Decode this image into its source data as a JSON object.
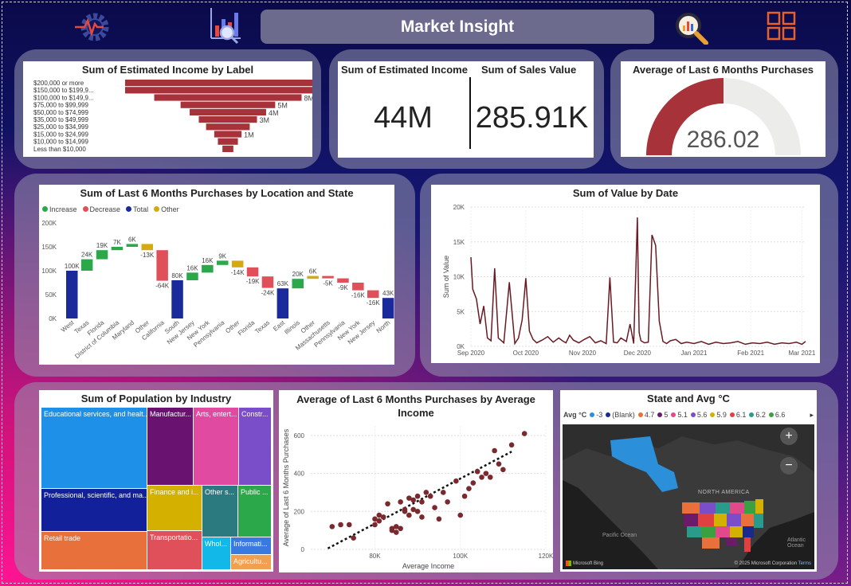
{
  "header": {
    "title": "Market Insight"
  },
  "icons": {
    "pulse": "settings-pulse-icon",
    "analytics": "analytics-chart-icon",
    "search": "search-analytics-icon",
    "grid": "grid-menu-icon"
  },
  "income_label": {
    "title": "Sum of Estimated Income by Label",
    "labels": [
      "$200,000 or more",
      "$150,000 to $199,9...",
      "$100,000 to $149,9...",
      "$75,000 to $99,999",
      "$50,000 to $74,999",
      "$35,000 to $49,999",
      "$25,000 to $34,999",
      "$15,000 to $24,999",
      "$10,000 to $14,999",
      "Less than $10,000"
    ],
    "data_labels": [
      "",
      "",
      "8M",
      "5M",
      "4M",
      "3M",
      "",
      "1M",
      "",
      ""
    ]
  },
  "kpi": {
    "income_title": "Sum of Estimated Income",
    "income_value": "44M",
    "sales_title": "Sum of Sales Value",
    "sales_value": "285.91K"
  },
  "gauge": {
    "title": "Average of Last 6 Months Purchases",
    "value": "286.02"
  },
  "waterfall": {
    "title": "Sum of Last 6 Months Purchases by Location and State",
    "legend": [
      "Increase",
      "Decrease",
      "Total",
      "Other"
    ],
    "yticks": [
      "200K",
      "150K",
      "100K",
      "50K",
      "0K"
    ]
  },
  "line": {
    "title": "Sum of Value by Date",
    "ylabel": "Sum of Value",
    "yticks": [
      "20K",
      "15K",
      "10K",
      "5K",
      "0K"
    ],
    "xticks": [
      "Sep 2020",
      "Oct 2020",
      "Nov 2020",
      "Dec 2020",
      "Jan 2021",
      "Feb 2021",
      "Mar 2021"
    ]
  },
  "treemap": {
    "title": "Sum of Population by Industry",
    "cells": [
      "Educational services, and healt...",
      "Manufactur...",
      "Arts, entert...",
      "Constr...",
      "Professional, scientific, and ma...",
      "Finance and i...",
      "Other s...",
      "Public ...",
      "Retail trade",
      "Transportatio...",
      "Whol...",
      "Informati...",
      "Agricultu..."
    ]
  },
  "scatter": {
    "title_line1": "Average of Last 6 Months Purchases by Average",
    "title_line2": "Income",
    "ylabel": "Average of Last 6 Months Purchases",
    "xlabel": "Average Income",
    "yticks": [
      "600",
      "400",
      "200",
      "0"
    ],
    "xticks": [
      "80K",
      "100K",
      "120K"
    ]
  },
  "map": {
    "title": "State and Avg °C",
    "legend_label": "Avg °C",
    "legend": [
      "-3",
      "(Blank)",
      "4.7",
      "5",
      "5.1",
      "5.6",
      "5.9",
      "6.1",
      "6.2",
      "6.6"
    ],
    "legend_colors": [
      "#2b8fd9",
      "#1a2a8a",
      "#e8703a",
      "#6a1b6a",
      "#e04a8a",
      "#7a4ec8",
      "#d4b000",
      "#e04040",
      "#2a9a8a",
      "#3aa040"
    ],
    "na_label": "NORTH AMERICA",
    "ocean_label": "Pacific Ocean",
    "ocean2_label": "Atlantic Ocean",
    "brand": "Microsoft Bing",
    "copyright": "© 2025 Microsoft Corporation",
    "terms": "Terms",
    "zoom_in": "+",
    "zoom_out": "−"
  },
  "chart_data": [
    {
      "type": "bar",
      "title": "Sum of Estimated Income by Label",
      "categories": [
        "$200,000 or more",
        "$150,000 to $199,9...",
        "$100,000 to $149,9...",
        "$75,000 to $99,999",
        "$50,000 to $74,999",
        "$35,000 to $49,999",
        "$25,000 to $34,999",
        "$15,000 to $24,999",
        "$10,000 to $14,999",
        "Less than $10,000"
      ],
      "values": [
        11.3,
        11.3,
        8.1,
        5.2,
        4.2,
        3.2,
        2.4,
        1.5,
        1.1,
        0.6
      ],
      "units": "M"
    },
    {
      "type": "bar",
      "subtype": "waterfall",
      "title": "Sum of Last 6 Months Purchases by Location and State",
      "categories": [
        "West",
        "Texas",
        "Florida",
        "District of Columbia",
        "Maryland",
        "Other",
        "California",
        "South",
        "New Jersey",
        "New York",
        "Pennsylvania",
        "Other",
        "Florida",
        "Texas",
        "East",
        "Illinois",
        "Other",
        "Massachusetts",
        "Pennsylvania",
        "New York",
        "New Jersey",
        "North"
      ],
      "kinds": [
        "total",
        "inc",
        "inc",
        "inc",
        "inc",
        "other",
        "dec",
        "total",
        "inc",
        "inc",
        "inc",
        "other",
        "dec",
        "dec",
        "total",
        "inc",
        "other",
        "dec",
        "dec",
        "dec",
        "dec",
        "total"
      ],
      "values": [
        100,
        24,
        19,
        7,
        6,
        -13,
        -64,
        80,
        16,
        16,
        9,
        -14,
        -19,
        -24,
        63,
        20,
        6,
        -5,
        -9,
        -16,
        -16,
        43
      ],
      "labels": [
        "100K",
        "24K",
        "19K",
        "7K",
        "6K",
        "-13K",
        "-64K",
        "80K",
        "16K",
        "16K",
        "9K",
        "-14K",
        "-19K",
        "-24K",
        "63K",
        "20K",
        "6K",
        "-5K",
        "-9K",
        "-16K",
        "-16K",
        "43K"
      ],
      "ylim": [
        0,
        200
      ],
      "units": "K"
    },
    {
      "type": "line",
      "title": "Sum of Value by Date",
      "xlabel": "",
      "ylabel": "Sum of Value",
      "ylim": [
        0,
        20000
      ],
      "x": [
        "2020-09-01",
        "2020-09-02",
        "2020-09-04",
        "2020-09-06",
        "2020-09-08",
        "2020-09-10",
        "2020-09-12",
        "2020-09-14",
        "2020-09-16",
        "2020-09-19",
        "2020-09-22",
        "2020-09-25",
        "2020-09-27",
        "2020-09-29",
        "2020-10-01",
        "2020-10-03",
        "2020-10-05",
        "2020-10-07",
        "2020-10-10",
        "2020-10-13",
        "2020-10-16",
        "2020-10-19",
        "2020-10-21",
        "2020-10-23",
        "2020-10-25",
        "2020-10-27",
        "2020-10-30",
        "2020-11-02",
        "2020-11-05",
        "2020-11-08",
        "2020-11-11",
        "2020-11-14",
        "2020-11-16",
        "2020-11-18",
        "2020-11-20",
        "2020-11-22",
        "2020-11-25",
        "2020-11-27",
        "2020-11-29",
        "2020-12-01",
        "2020-12-02",
        "2020-12-03",
        "2020-12-05",
        "2020-12-07",
        "2020-12-09",
        "2020-12-11",
        "2020-12-13",
        "2020-12-15",
        "2020-12-17",
        "2020-12-19",
        "2020-12-22",
        "2020-12-25",
        "2020-12-28",
        "2021-01-01",
        "2021-01-05",
        "2021-01-09",
        "2021-01-13",
        "2021-01-17",
        "2021-01-21",
        "2021-01-25",
        "2021-01-29",
        "2021-02-02",
        "2021-02-06",
        "2021-02-10",
        "2021-02-14",
        "2021-02-18",
        "2021-02-22",
        "2021-02-26",
        "2021-03-01",
        "2021-03-03"
      ],
      "y": [
        12800,
        8200,
        6800,
        3200,
        5800,
        1200,
        800,
        11200,
        1200,
        500,
        9200,
        400,
        1200,
        3800,
        9800,
        2200,
        1000,
        500,
        900,
        1400,
        600,
        1200,
        800,
        500,
        1600,
        900,
        500,
        1000,
        1400,
        500,
        800,
        400,
        9900,
        600,
        500,
        1200,
        700,
        3200,
        400,
        18500,
        2000,
        800,
        500,
        600,
        16000,
        14500,
        3600,
        700,
        400,
        800,
        1000,
        400,
        600,
        400,
        700,
        300,
        600,
        400,
        500,
        700,
        300,
        500,
        400,
        600,
        300,
        500,
        400,
        600,
        300,
        700
      ]
    },
    {
      "type": "scatter",
      "title": "Average of Last 6 Months Purchases by Average Income",
      "xlabel": "Average Income",
      "ylabel": "Average of Last 6 Months Purchases",
      "xlim": [
        65000,
        120000
      ],
      "ylim": [
        0,
        650
      ],
      "x": [
        70000,
        72000,
        74000,
        75000,
        80000,
        80000,
        81000,
        81000,
        82000,
        83000,
        84000,
        84000,
        85000,
        85000,
        86000,
        86000,
        87000,
        87000,
        88000,
        88000,
        89000,
        89000,
        90000,
        90000,
        91000,
        91000,
        92000,
        93000,
        94000,
        95000,
        96000,
        97000,
        99000,
        100000,
        101000,
        102000,
        103000,
        104000,
        105000,
        106000,
        107000,
        108000,
        109000,
        110000,
        112000,
        115000
      ],
      "y": [
        120,
        130,
        130,
        60,
        160,
        130,
        150,
        180,
        170,
        240,
        110,
        100,
        90,
        120,
        250,
        110,
        210,
        200,
        180,
        270,
        210,
        260,
        280,
        200,
        170,
        250,
        300,
        280,
        220,
        160,
        300,
        250,
        360,
        180,
        280,
        320,
        350,
        410,
        380,
        400,
        380,
        520,
        450,
        420,
        550,
        610
      ],
      "trend": {
        "x": [
          69000,
          112000
        ],
        "y": [
          5,
          515
        ]
      }
    },
    {
      "type": "treemap",
      "title": "Sum of Population by Industry",
      "categories": [
        "Educational services, and healt...",
        "Professional, scientific, and ma...",
        "Retail trade",
        "Manufactur...",
        "Finance and i...",
        "Transportatio...",
        "Arts, entert...",
        "Other s...",
        "Whol...",
        "Informati...",
        "Agricultu...",
        "Constr...",
        "Public ..."
      ]
    }
  ]
}
